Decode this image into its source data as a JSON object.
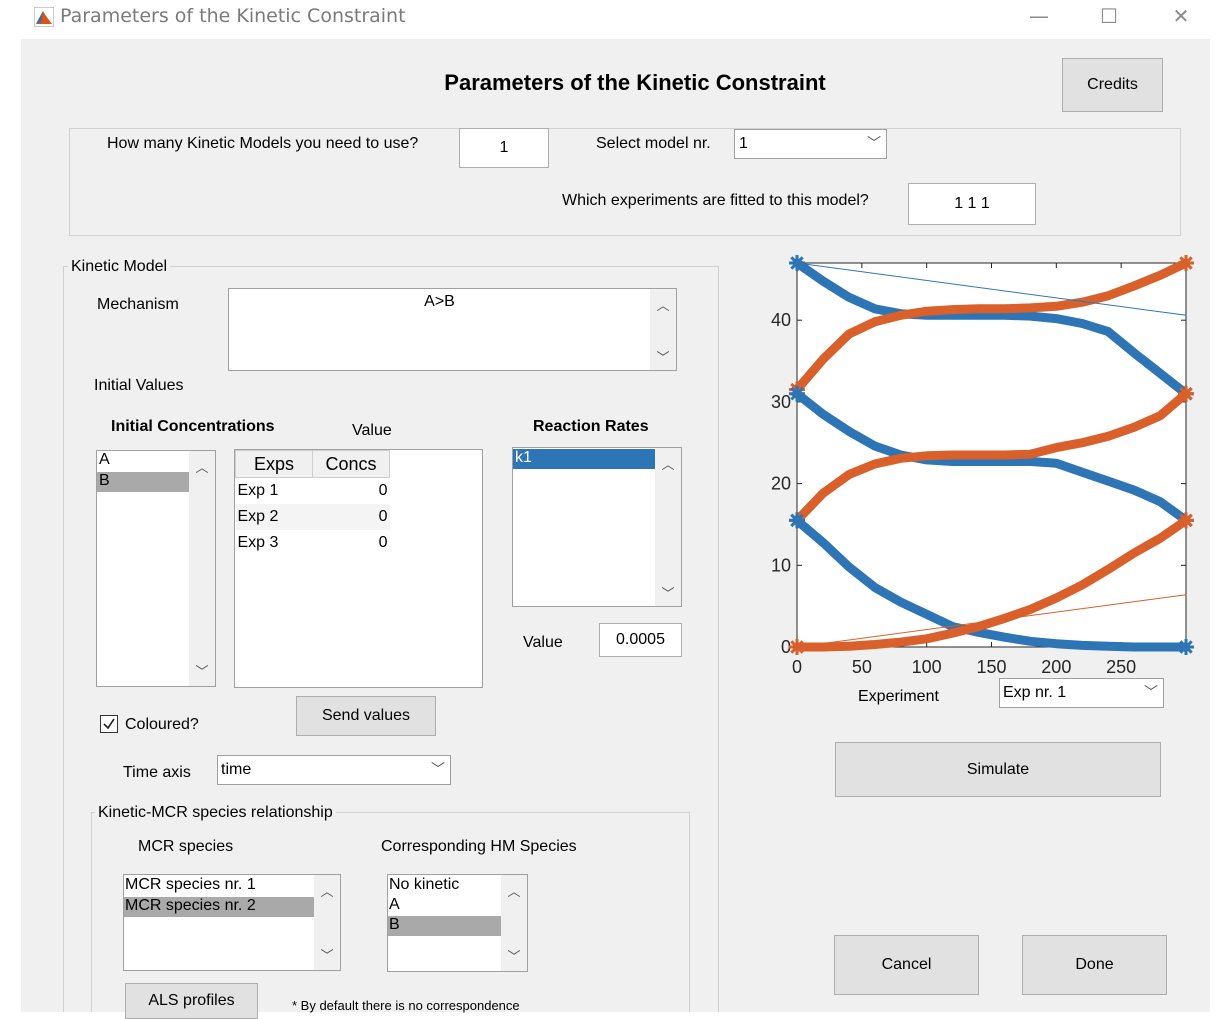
{
  "window": {
    "title": "Parameters of the Kinetic Constraint",
    "min": "—",
    "max": "☐",
    "close": "✕"
  },
  "header": {
    "title": "Parameters of the Kinetic Constraint",
    "credits": "Credits"
  },
  "models": {
    "count_label": "How many Kinetic Models you need to use?",
    "count_value": "1",
    "select_label": "Select model nr.",
    "select_value": "1",
    "experiments_label": "Which experiments are fitted to this model?",
    "experiments_value": "1  1  1"
  },
  "kinetic": {
    "legend": "Kinetic Model",
    "mechanism_label": "Mechanism",
    "mechanism_value": "A>B",
    "initial_values_label": "Initial Values",
    "init_conc_label": "Initial Concentrations",
    "value_label": "Value",
    "species": [
      "A",
      "B"
    ],
    "table_headers": [
      "Exps",
      "Concs"
    ],
    "table_rows": [
      [
        "Exp 1",
        "0"
      ],
      [
        "Exp 2",
        "0"
      ],
      [
        "Exp 3",
        "0"
      ]
    ],
    "rates_label": "Reaction Rates",
    "rates": [
      "k1"
    ],
    "rate_value_label": "Value",
    "rate_value": "0.0005",
    "send_values": "Send values",
    "coloured_label": "Coloured?",
    "time_axis_label": "Time axis",
    "time_axis_value": "time"
  },
  "relationship": {
    "legend": "Kinetic-MCR species relationship",
    "mcr_label": "MCR species",
    "hm_label": "Corresponding HM Species",
    "mcr_items": [
      "MCR species nr. 1",
      "MCR species nr. 2"
    ],
    "hm_items": [
      "No kinetic",
      "A",
      "B"
    ],
    "als_button": "ALS profiles",
    "note": "* By default there is no correspondence"
  },
  "plot": {
    "xlabel": "Experiment",
    "exp_select": "Exp nr. 1",
    "simulate": "Simulate",
    "xticks": [
      "0",
      "50",
      "100",
      "150",
      "200",
      "250"
    ],
    "yticks": [
      "0",
      "10",
      "20",
      "30",
      "40"
    ]
  },
  "chart_data": {
    "type": "line",
    "xlabel": "Experiment",
    "ylabel": "",
    "xlim": [
      0,
      300
    ],
    "ylim": [
      0,
      47
    ],
    "series": [
      {
        "color": "#2e75b6",
        "x": [
          0,
          20,
          40,
          60,
          80,
          100,
          120,
          140,
          160,
          180,
          200,
          220,
          240,
          260,
          280,
          300
        ],
        "y": [
          47,
          44.8,
          42.8,
          41.4,
          40.8,
          40.6,
          40.6,
          40.6,
          40.6,
          40.5,
          40.2,
          39.6,
          38.6,
          36,
          33.5,
          31
        ]
      },
      {
        "color": "#d95f2b",
        "x": [
          0,
          20,
          40,
          60,
          80,
          100,
          120,
          140,
          160,
          180,
          200,
          220,
          240,
          260,
          280,
          300
        ],
        "y": [
          31.5,
          35.2,
          38.3,
          39.8,
          40.6,
          41.1,
          41.3,
          41.4,
          41.4,
          41.5,
          41.7,
          42.2,
          43,
          44.2,
          45.5,
          47
        ]
      },
      {
        "color": "#2e75b6",
        "x": [
          0,
          20,
          40,
          60,
          80,
          100,
          120,
          140,
          160,
          180,
          200,
          220,
          240,
          260,
          280,
          300
        ],
        "y": [
          31,
          28.5,
          26.4,
          24.6,
          23.5,
          22.9,
          22.7,
          22.7,
          22.7,
          22.7,
          22.5,
          21.4,
          20.3,
          19.2,
          17.8,
          15.5
        ]
      },
      {
        "color": "#d95f2b",
        "x": [
          0,
          20,
          40,
          60,
          80,
          100,
          120,
          140,
          160,
          180,
          200,
          220,
          240,
          260,
          280,
          300
        ],
        "y": [
          15.5,
          18.8,
          21.1,
          22.4,
          23.1,
          23.4,
          23.5,
          23.5,
          23.5,
          23.6,
          24.4,
          25,
          25.8,
          26.9,
          28.3,
          31
        ]
      },
      {
        "color": "#2e75b6",
        "x": [
          0,
          20,
          40,
          60,
          80,
          100,
          120,
          140,
          160,
          180,
          200,
          220,
          240,
          260,
          280,
          300
        ],
        "y": [
          15.5,
          12.8,
          9.8,
          7.3,
          5.5,
          4,
          2.5,
          1.8,
          1.2,
          0.7,
          0.4,
          0.2,
          0.1,
          0,
          0,
          0
        ]
      },
      {
        "color": "#d95f2b",
        "x": [
          0,
          20,
          40,
          60,
          80,
          100,
          120,
          140,
          160,
          180,
          200,
          220,
          240,
          260,
          280,
          300
        ],
        "y": [
          0,
          0,
          0.1,
          0.3,
          0.6,
          1,
          1.7,
          2.5,
          3.5,
          4.6,
          6,
          7.6,
          9.5,
          11.5,
          13.3,
          15.5
        ]
      },
      {
        "color": "#2e75b6",
        "x": [
          0,
          300
        ],
        "y": [
          47,
          40.6
        ]
      },
      {
        "color": "#d95f2b",
        "x": [
          0,
          300
        ],
        "y": [
          0,
          6.4
        ]
      }
    ]
  }
}
